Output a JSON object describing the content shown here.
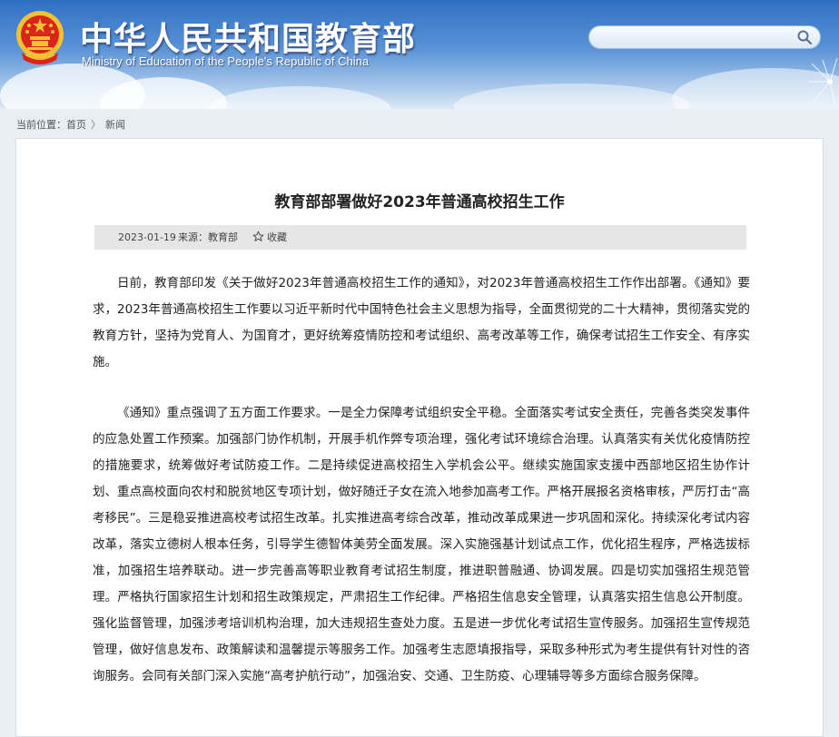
{
  "header": {
    "site_name_cn": "中华人民共和国教育部",
    "site_name_en": "Ministry of Education of the People's Republic of China",
    "emblem_icon": "national-emblem-icon",
    "search": {
      "placeholder": "",
      "value": "",
      "icon": "search-icon"
    }
  },
  "breadcrumb": {
    "prefix": "当前位置：",
    "items": [
      "首页",
      "新闻"
    ],
    "separator": "〉"
  },
  "article": {
    "title": "教育部部署做好2023年普通高校招生工作",
    "meta": {
      "date": "2023-01-19",
      "source_label": "来源：",
      "source": "教育部",
      "favorite_label": "收藏",
      "favorite_icon": "star-icon"
    },
    "paragraphs": [
      "日前，教育部印发《关于做好2023年普通高校招生工作的通知》，对2023年普通高校招生工作作出部署。《通知》要求，2023年普通高校招生工作要以习近平新时代中国特色社会主义思想为指导，全面贯彻党的二十大精神，贯彻落实党的教育方针，坚持为党育人、为国育才，更好统筹疫情防控和考试组织、高考改革等工作，确保考试招生工作安全、有序实施。",
      "《通知》重点强调了五方面工作要求。一是全力保障考试组织安全平稳。全面落实考试安全责任，完善各类突发事件的应急处置工作预案。加强部门协作机制，开展手机作弊专项治理，强化考试环境综合治理。认真落实有关优化疫情防控的措施要求，统筹做好考试防疫工作。二是持续促进高校招生入学机会公平。继续实施国家支援中西部地区招生协作计划、重点高校面向农村和脱贫地区专项计划，做好随迁子女在流入地参加高考工作。严格开展报名资格审核，严厉打击“高考移民”。三是稳妥推进高校考试招生改革。扎实推进高考综合改革，推动改革成果进一步巩固和深化。持续深化考试内容改革，落实立德树人根本任务，引导学生德智体美劳全面发展。深入实施强基计划试点工作，优化招生程序，严格选拔标准，加强招生培养联动。进一步完善高等职业教育考试招生制度，推进职普融通、协调发展。四是切实加强招生规范管理。严格执行国家招生计划和招生政策规定，严肃招生工作纪律。严格招生信息安全管理，认真落实招生信息公开制度。强化监督管理，加强涉考培训机构治理，加大违规招生查处力度。五是进一步优化考试招生宣传服务。加强招生宣传规范管理，做好信息发布、政策解读和温馨提示等服务工作。加强考生志愿填报指导，采取多种形式为考生提供有针对性的咨询服务。会同有关部门深入实施“高考护航行动”，加强治安、交通、卫生防疫、心理辅导等多方面综合服务保障。"
    ]
  },
  "colors": {
    "banner_top": "#2f6fc4",
    "banner_bottom": "#dce8f5",
    "emblem_red": "#d8261c",
    "emblem_gold": "#f2c230",
    "meta_bar_bg": "#e6e6e6"
  }
}
